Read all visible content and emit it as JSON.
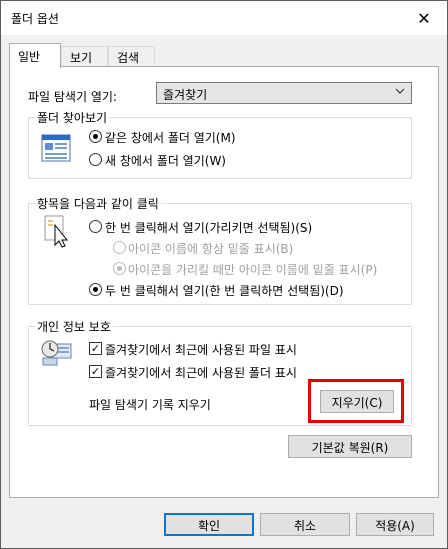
{
  "window": {
    "title": "폴더 옵션",
    "close_glyph": "✕"
  },
  "tabs": [
    {
      "label": "일반",
      "active": true
    },
    {
      "label": "보기",
      "active": false
    },
    {
      "label": "검색",
      "active": false
    }
  ],
  "open_explorer": {
    "label": "파일 탐색기 열기:",
    "value": "즐겨찾기"
  },
  "browse_folders": {
    "legend": "폴더 찾아보기",
    "options": [
      {
        "label": "같은 창에서 폴더 열기(M)",
        "checked": true
      },
      {
        "label": "새 창에서 폴더 열기(W)",
        "checked": false
      }
    ]
  },
  "click_items": {
    "legend": "항목을 다음과 같이 클릭",
    "single": {
      "label": "한 번 클릭해서 열기(가리키면 선택됨)(S)",
      "checked": false
    },
    "underline_always": {
      "label": "아이콘 이름에 항상 밑줄 표시(B)",
      "checked": false,
      "disabled": true
    },
    "underline_point": {
      "label": "아이콘을 가리킬 때만 아이콘 이름에 밑줄 표시(P)",
      "checked": true,
      "disabled": true
    },
    "double": {
      "label": "두 번 클릭해서 열기(한 번 클릭하면 선택됨)(D)",
      "checked": true
    }
  },
  "privacy": {
    "legend": "개인 정보 보호",
    "recent_files": {
      "label": "즐겨찾기에서 최근에 사용된 파일 표시",
      "checked": true
    },
    "recent_folders": {
      "label": "즐겨찾기에서 최근에 사용된 폴더 표시",
      "checked": true
    },
    "clear_label": "파일 탐색기 기록 지우기",
    "clear_button": "지우기(C)"
  },
  "restore_defaults": "기본값 복원(R)",
  "footer": {
    "ok": "확인",
    "cancel": "취소",
    "apply": "적용(A)"
  },
  "colors": {
    "highlight": "#e00000",
    "accent": "#0078d7"
  }
}
